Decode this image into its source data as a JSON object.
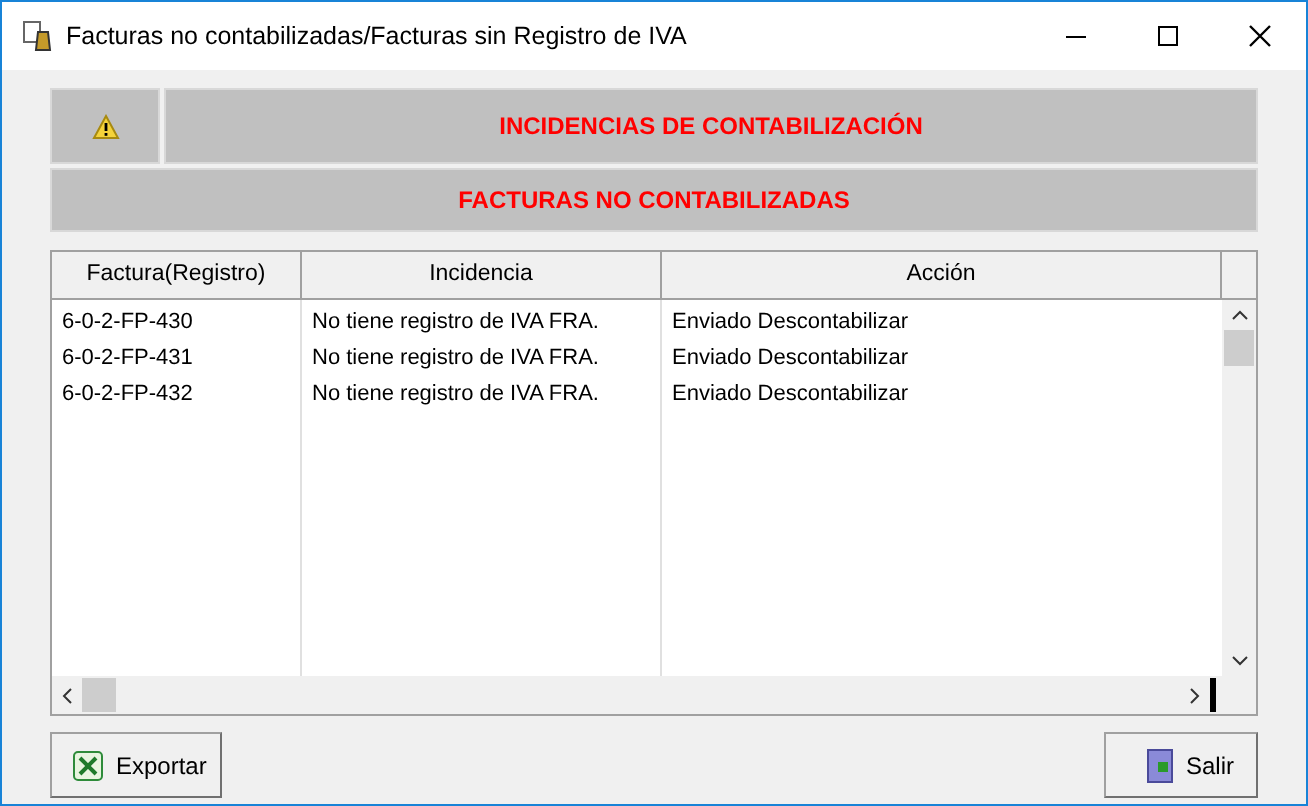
{
  "window": {
    "title": "Facturas no contabilizadas/Facturas sin Registro de IVA"
  },
  "banner": {
    "title": "INCIDENCIAS DE CONTABILIZACIÓN",
    "subtitle": "FACTURAS NO CONTABILIZADAS"
  },
  "table": {
    "columns": [
      "Factura(Registro)",
      "Incidencia",
      "Acción"
    ],
    "rows": [
      [
        "6-0-2-FP-430",
        "No tiene registro de IVA FRA.",
        "Enviado Descontabilizar"
      ],
      [
        "6-0-2-FP-431",
        "No tiene registro de IVA FRA.",
        "Enviado Descontabilizar"
      ],
      [
        "6-0-2-FP-432",
        "No tiene registro de IVA FRA.",
        "Enviado Descontabilizar"
      ]
    ]
  },
  "buttons": [
    {
      "kind": "export",
      "label": "Exportar"
    },
    {
      "kind": "exit",
      "label": "Salir"
    }
  ]
}
